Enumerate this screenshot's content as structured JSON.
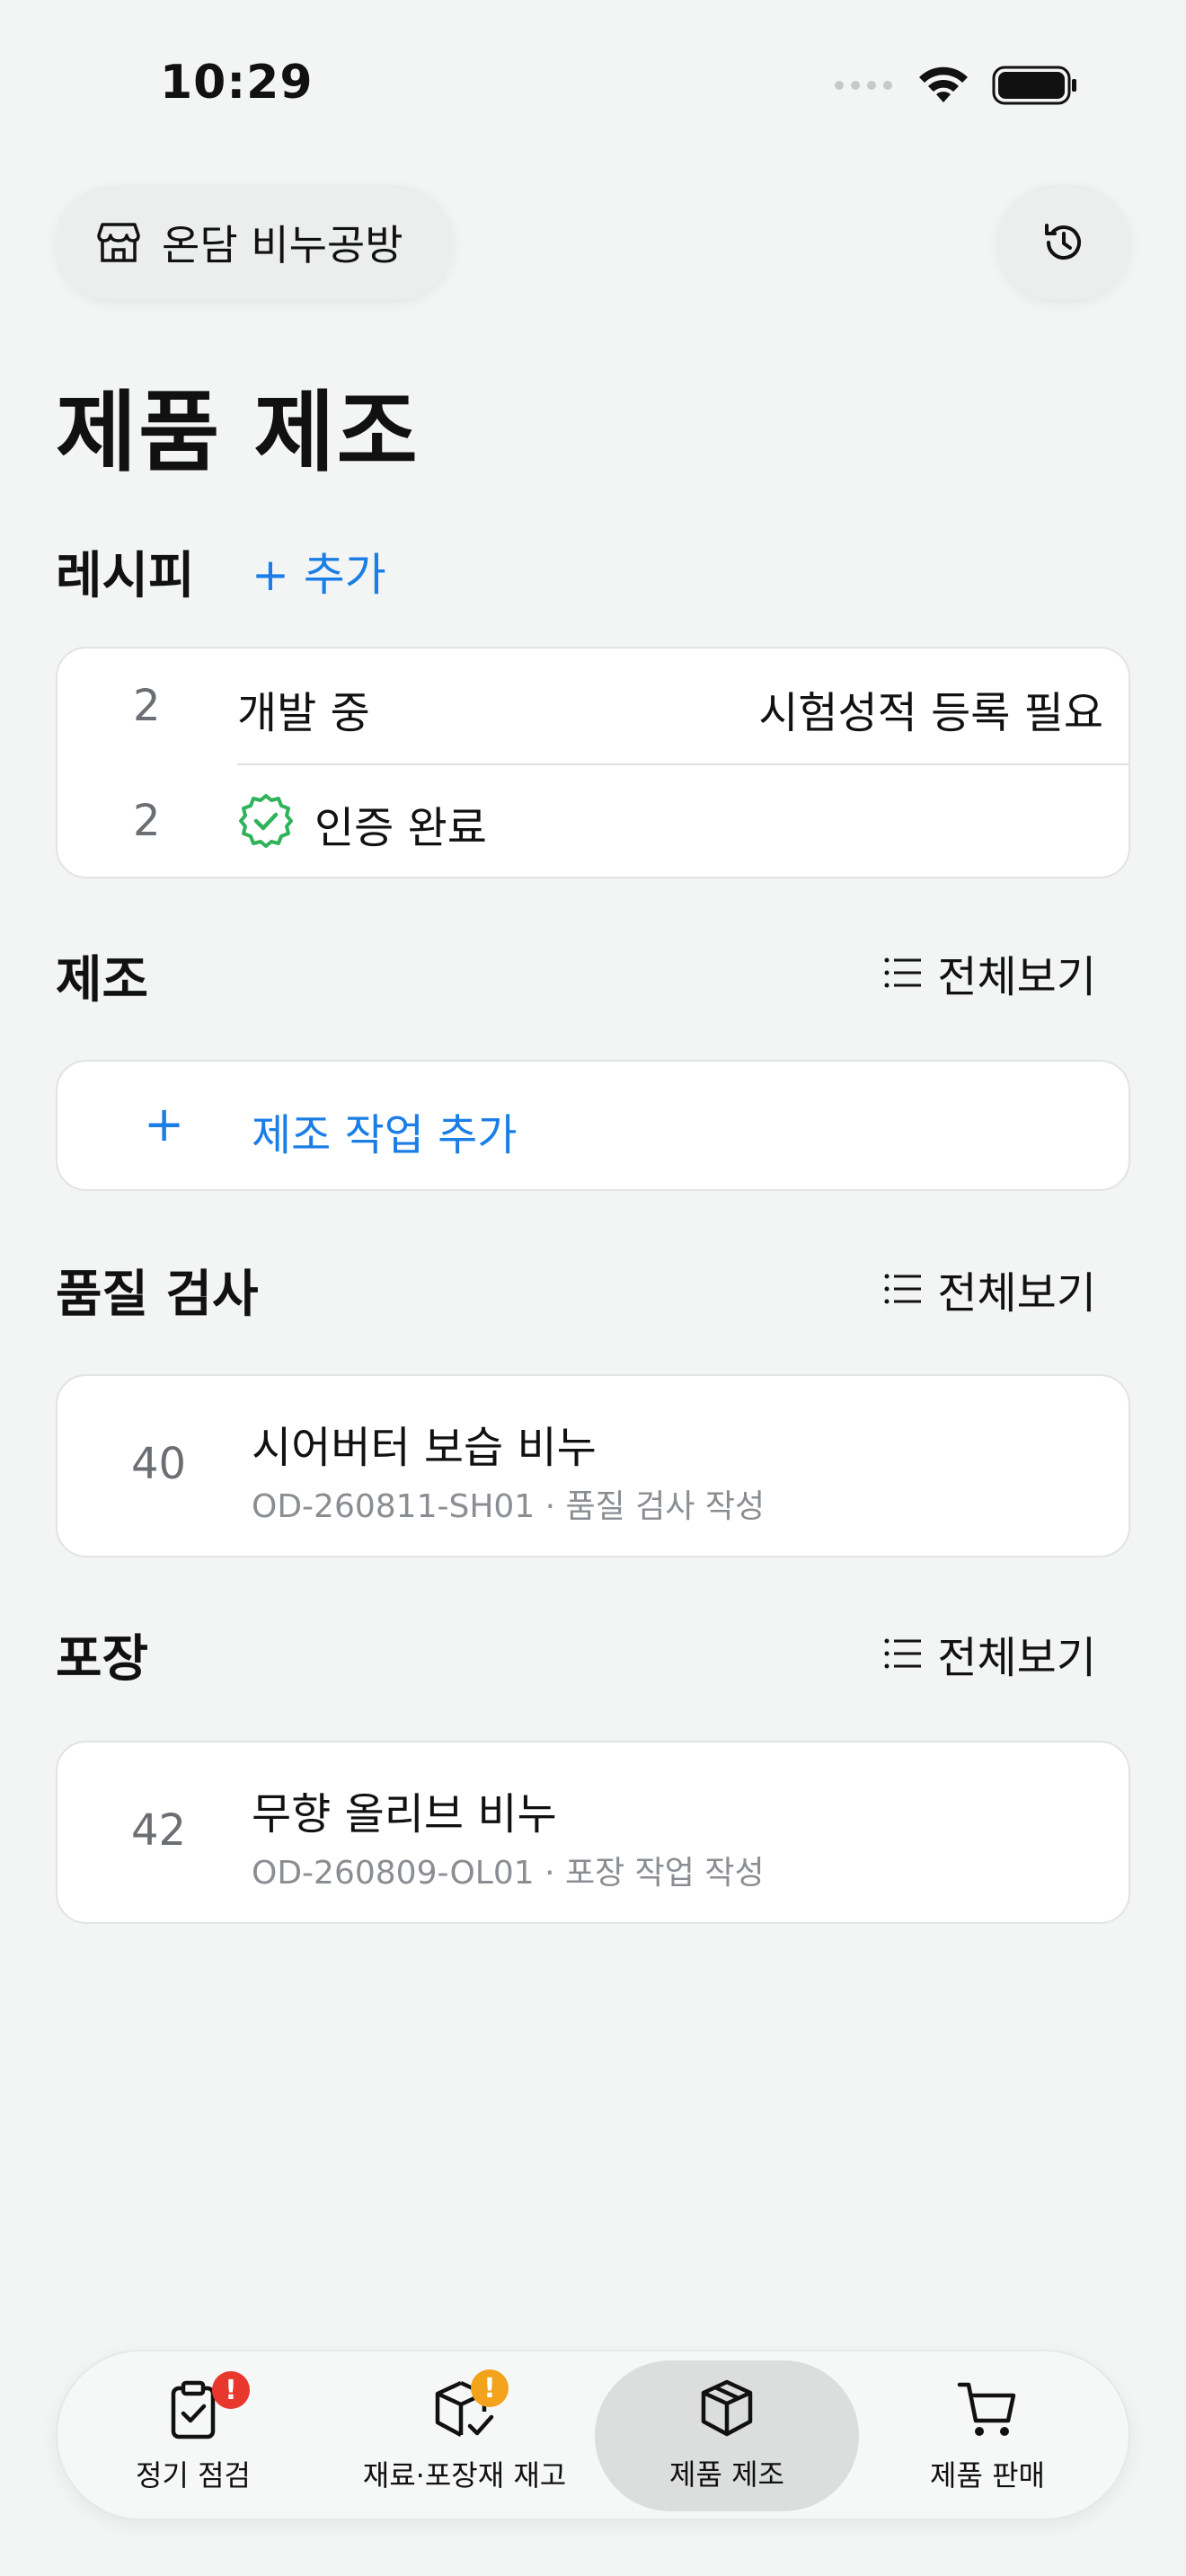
{
  "status_bar": {
    "time": "10:29"
  },
  "header": {
    "shop_name": "온담 비누공방",
    "title": "제품 제조"
  },
  "recipes": {
    "title": "레시피",
    "add_label": "+ 추가",
    "rows": [
      {
        "count": "2",
        "label": "개발 중",
        "note": "시험성적 등록 필요"
      },
      {
        "count": "2",
        "label": "인증 완료",
        "note": ""
      }
    ]
  },
  "manufacturing": {
    "title": "제조",
    "view_all": "전체보기",
    "add_plus": "+",
    "add_label": "제조 작업 추가"
  },
  "quality": {
    "title": "품질 검사",
    "view_all": "전체보기",
    "item": {
      "count": "40",
      "name": "시어버터 보습 비누",
      "detail": "OD-260811-SH01 · 품질 검사 작성"
    }
  },
  "packaging": {
    "title": "포장",
    "view_all": "전체보기",
    "item": {
      "count": "42",
      "name": "무향 올리브 비누",
      "detail": "OD-260809-OL01 · 포장 작업 작성"
    }
  },
  "tabbar": {
    "tabs": [
      {
        "label": "정기 점검",
        "badge": "!",
        "badge_color": "#e8372c",
        "active": false
      },
      {
        "label": "재료·포장재 재고",
        "badge": "!",
        "badge_color": "#f2a31b",
        "active": false
      },
      {
        "label": "제품 제조",
        "badge": "",
        "active": true
      },
      {
        "label": "제품 판매",
        "badge": "",
        "active": false
      }
    ]
  },
  "colors": {
    "accent": "#1a7ee6",
    "success": "#2fb35a",
    "background": "#f3f4f4"
  }
}
